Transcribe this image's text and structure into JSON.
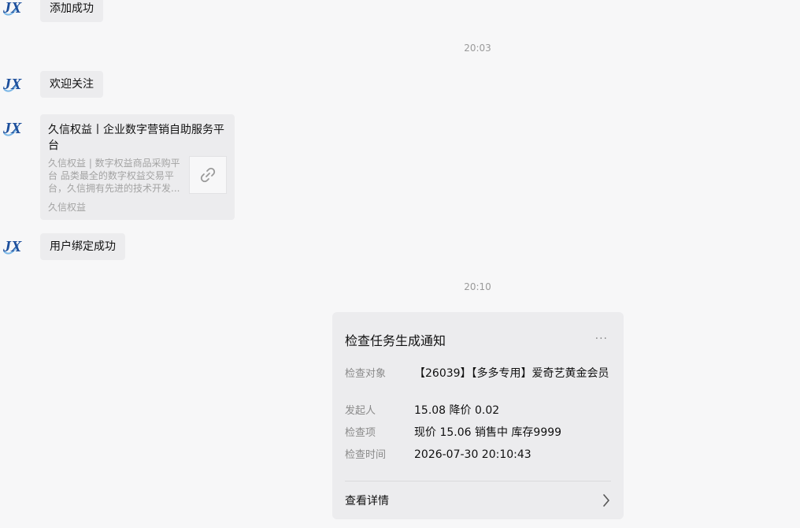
{
  "messages": {
    "added_success": "添加成功",
    "time_1": "20:03",
    "welcome": "欢迎关注",
    "bind_success": "用户绑定成功",
    "time_2": "20:10"
  },
  "link_card": {
    "title": "久信权益丨企业数字营销自助服务平台",
    "description": "久信权益 | 数字权益商品采购平台 品类最全的数字权益交易平台，久信拥有先进的技术开发...",
    "source": "久信权益",
    "thumb_icon": "link-icon"
  },
  "notice": {
    "title": "检查任务生成通知",
    "more": "···",
    "rows": [
      {
        "label": "检查对象",
        "value": "【26039】【多多专用】爱奇艺黄金会员"
      },
      {
        "label": "发起人",
        "value": "15.08 降价 0.02"
      },
      {
        "label": "检查项",
        "value": "现价 15.06 销售中 库存9999"
      },
      {
        "label": "检查时间",
        "value": "2026-07-30 20:10:43"
      }
    ],
    "detail_label": "查看详情"
  },
  "colors": {
    "background": "#f7f7f8",
    "bubble": "#ececee",
    "avatar_blue": "#1d4f9c"
  }
}
